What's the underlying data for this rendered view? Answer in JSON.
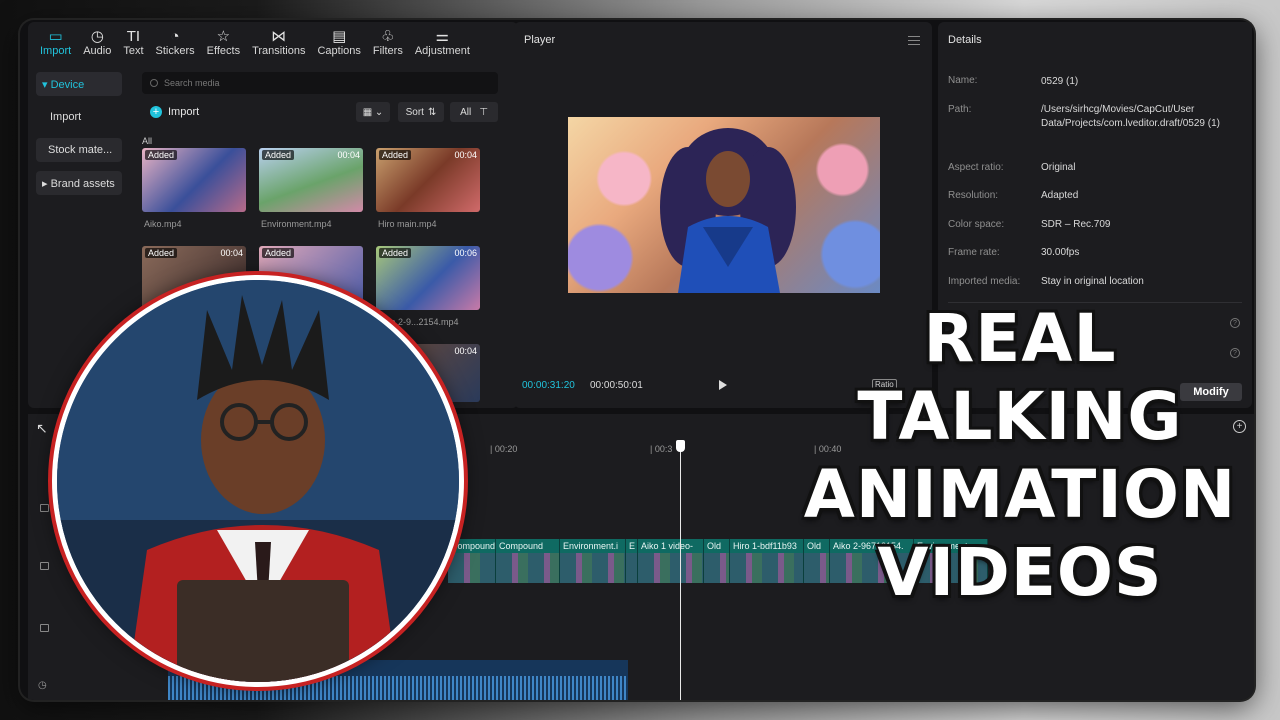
{
  "toolbar": {
    "items": [
      {
        "label": "Import",
        "icon": "import-icon",
        "glyph": "▭",
        "active": true
      },
      {
        "label": "Audio",
        "icon": "audio-icon",
        "glyph": "◷",
        "active": false
      },
      {
        "label": "Text",
        "icon": "text-icon",
        "glyph": "TI",
        "active": false
      },
      {
        "label": "Stickers",
        "icon": "stickers-icon",
        "glyph": "◔",
        "active": false
      },
      {
        "label": "Effects",
        "icon": "effects-icon",
        "glyph": "☆",
        "active": false
      },
      {
        "label": "Transitions",
        "icon": "transitions-icon",
        "glyph": "⋈",
        "active": false
      },
      {
        "label": "Captions",
        "icon": "captions-icon",
        "glyph": "▤",
        "active": false
      },
      {
        "label": "Filters",
        "icon": "filters-icon",
        "glyph": "♧",
        "active": false
      },
      {
        "label": "Adjustment",
        "icon": "adjustment-icon",
        "glyph": "⚌",
        "active": false
      }
    ]
  },
  "sidebar": {
    "items": [
      "▾ Device",
      "Import",
      "Stock mate...",
      "▸ Brand assets"
    ]
  },
  "media": {
    "search_placeholder": "Search media",
    "import_label": "Import",
    "sort_label": "Sort",
    "all_filter_label": "All",
    "section_label": "All",
    "items": [
      {
        "name": "Aiko.mp4",
        "badge": "Added",
        "duration": ""
      },
      {
        "name": "Environment.mp4",
        "badge": "Added",
        "duration": "00:04"
      },
      {
        "name": "Hiro main.mp4",
        "badge": "Added",
        "duration": "00:04"
      },
      {
        "name": "",
        "badge": "Added",
        "duration": "00:04"
      },
      {
        "name": "",
        "badge": "Added",
        "duration": ""
      },
      {
        "name": "Aiko 2-9...2154.mp4",
        "badge": "Added",
        "duration": "00:06"
      }
    ],
    "extra_duration": "00:04"
  },
  "player": {
    "title": "Player",
    "current_time": "00:00:31:20",
    "total_time": "00:00:50:01",
    "ratio_label": "Ratio"
  },
  "details": {
    "title": "Details",
    "rows": [
      {
        "label": "Name:",
        "value": "0529 (1)"
      },
      {
        "label": "Path:",
        "value": "/Users/sirhcg/Movies/CapCut/User Data/Projects/com.lveditor.draft/0529 (1)"
      },
      {
        "label": "Aspect ratio:",
        "value": "Original"
      },
      {
        "label": "Resolution:",
        "value": "Adapted"
      },
      {
        "label": "Color space:",
        "value": "SDR – Rec.709"
      },
      {
        "label": "Frame rate:",
        "value": "30.00fps"
      },
      {
        "label": "Imported media:",
        "value": "Stay in original location"
      }
    ],
    "modify_label": "Modify"
  },
  "timeline": {
    "ruler": [
      "| 00:20",
      "| 00:3",
      "| 00:40"
    ],
    "clips": [
      "Compound",
      "Compound",
      "Environment.i",
      "E",
      "Aiko 1 video-",
      "Old",
      "Hiro 1-bdf11b93",
      "Old",
      "Aiko 2-96712154.",
      "Environment.r"
    ]
  },
  "headline": {
    "lines": [
      "REAL",
      "TALKING",
      "ANIMATION",
      "VIDEOS"
    ]
  },
  "colors": {
    "accent": "#21c3dc",
    "avatar_ring": "#c72222",
    "clip_teal": "#0f6a62"
  }
}
